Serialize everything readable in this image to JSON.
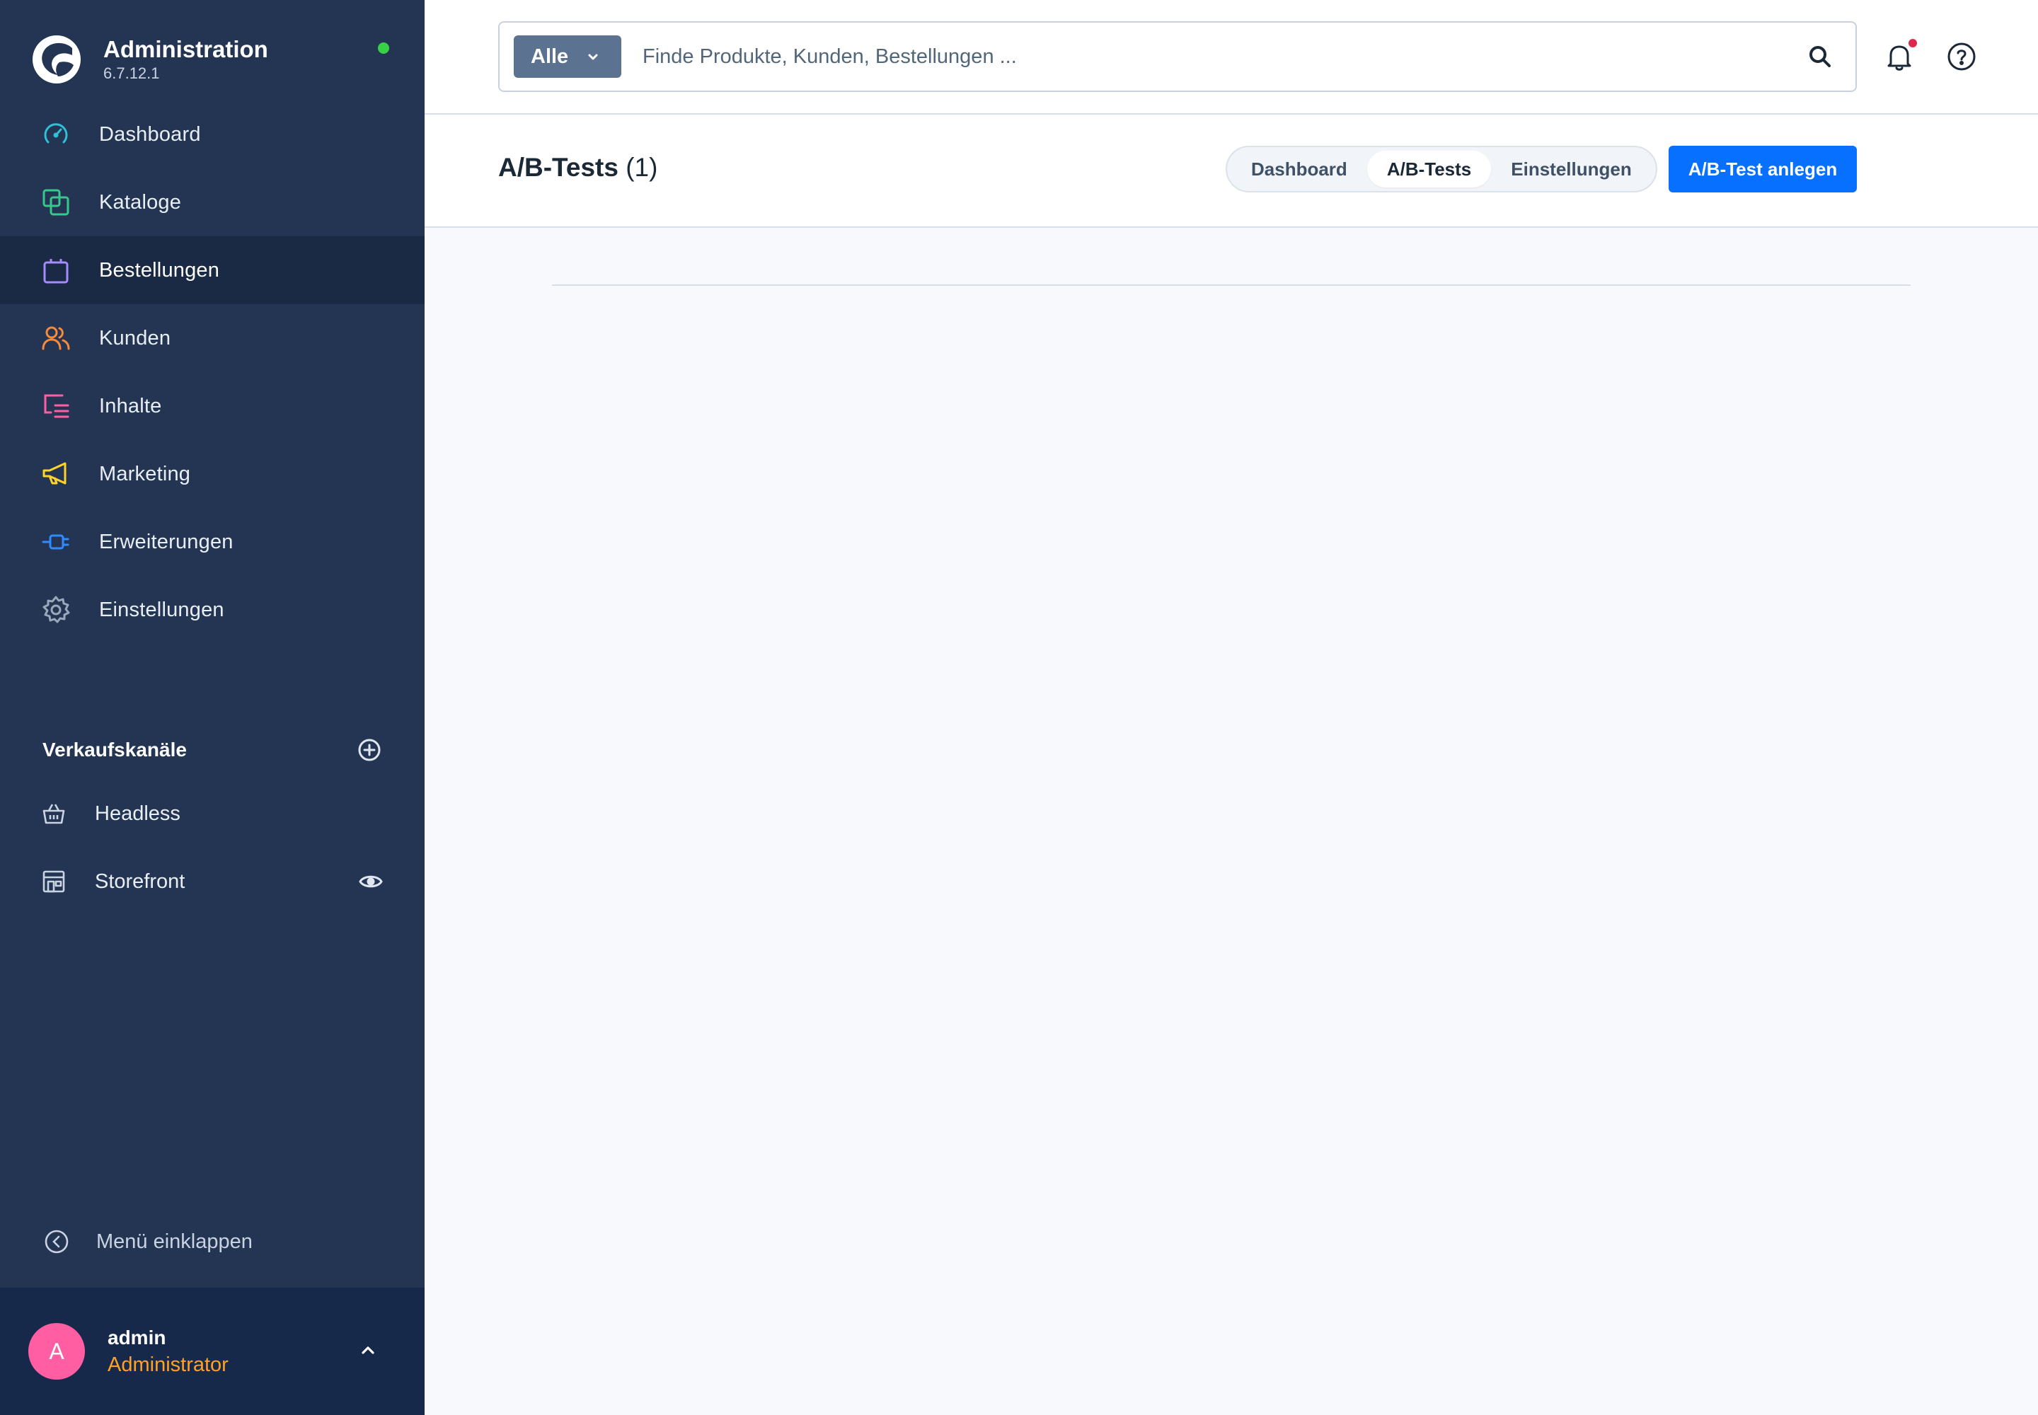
{
  "brand": {
    "title": "Administration",
    "version": "6.7.12.1",
    "status_color": "#37d046"
  },
  "nav": {
    "items": [
      {
        "label": "Dashboard",
        "icon": "dashboard-gauge-icon",
        "color": "#2fbfd8"
      },
      {
        "label": "Kataloge",
        "icon": "catalog-icon",
        "color": "#37c98c"
      },
      {
        "label": "Bestellungen",
        "icon": "shopping-bag-icon",
        "color": "#a58bff",
        "active": true
      },
      {
        "label": "Kunden",
        "icon": "customers-icon",
        "color": "#f88a3c"
      },
      {
        "label": "Inhalte",
        "icon": "content-icon",
        "color": "#ff5fa2"
      },
      {
        "label": "Marketing",
        "icon": "megaphone-icon",
        "color": "#ffd42a"
      },
      {
        "label": "Erweiterungen",
        "icon": "plugin-icon",
        "color": "#2f8bff"
      },
      {
        "label": "Einstellungen",
        "icon": "settings-gear-icon",
        "color": "#9aa8bb"
      }
    ]
  },
  "sales_channels": {
    "title": "Verkaufskanäle",
    "items": [
      {
        "label": "Headless",
        "icon": "basket-icon"
      },
      {
        "label": "Storefront",
        "icon": "storefront-icon",
        "has_eye": true
      }
    ]
  },
  "collapse": {
    "label": "Menü einklappen"
  },
  "user": {
    "initial": "A",
    "name": "admin",
    "role": "Administrator",
    "avatar_color": "#ff5fa2",
    "role_color": "#ffa127"
  },
  "search": {
    "filter_label": "Alle",
    "placeholder": "Finde Produkte, Kunden, Bestellungen ..."
  },
  "page": {
    "title": "A/B-Tests",
    "count": "(1)",
    "tabs": [
      {
        "label": "Dashboard",
        "active": false
      },
      {
        "label": "A/B-Tests",
        "active": true
      },
      {
        "label": "Einstellungen",
        "active": false
      }
    ],
    "primary_action": "A/B-Test anlegen",
    "primary_color": "#0870ff"
  }
}
